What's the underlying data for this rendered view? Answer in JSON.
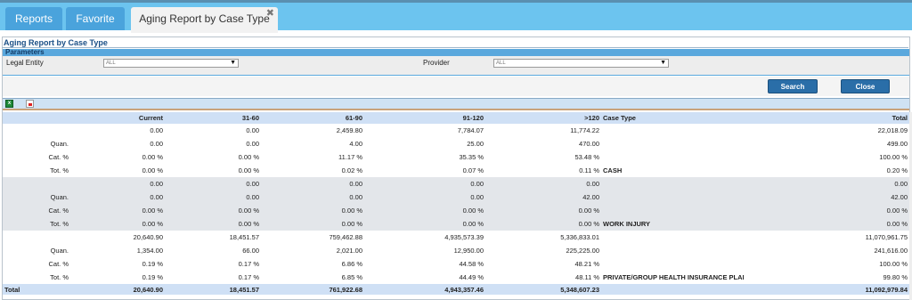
{
  "tabs": [
    {
      "label": "Reports"
    },
    {
      "label": "Favorite"
    },
    {
      "label": "Aging Report by Case Type",
      "active": true,
      "close": "✖"
    }
  ],
  "report": {
    "title": "Aging Report by Case Type",
    "parameters_label": "Parameters",
    "legal_entity": {
      "label": "Legal Entity",
      "value": "ALL"
    },
    "provider": {
      "label": "Provider",
      "value": "ALL"
    },
    "search_label": "Search",
    "close_label": "Close"
  },
  "table": {
    "headers": [
      "",
      "Current",
      "31-60",
      "61-90",
      "91-120",
      ">120",
      "Case Type",
      "Total"
    ],
    "groups": [
      {
        "case_type": "CASH",
        "rows": [
          {
            "label": "",
            "values": [
              "0.00",
              "0.00",
              "2,459.80",
              "7,784.07",
              "11,774.22"
            ],
            "total": "22,018.09"
          },
          {
            "label": "Quan.",
            "values": [
              "0.00",
              "0.00",
              "4.00",
              "25.00",
              "470.00"
            ],
            "total": "499.00"
          },
          {
            "label": "Cat. %",
            "values": [
              "0.00 %",
              "0.00 %",
              "11.17 %",
              "35.35 %",
              "53.48 %"
            ],
            "total": "100.00 %"
          },
          {
            "label": "Tot. %",
            "values": [
              "0.00 %",
              "0.00 %",
              "0.02 %",
              "0.07 %",
              "0.11 %"
            ],
            "total": "0.20 %"
          }
        ]
      },
      {
        "case_type": "WORK INJURY",
        "rows": [
          {
            "label": "",
            "values": [
              "0.00",
              "0.00",
              "0.00",
              "0.00",
              "0.00"
            ],
            "total": "0.00"
          },
          {
            "label": "Quan.",
            "values": [
              "0.00",
              "0.00",
              "0.00",
              "0.00",
              "42.00"
            ],
            "total": "42.00"
          },
          {
            "label": "Cat. %",
            "values": [
              "0.00 %",
              "0.00 %",
              "0.00 %",
              "0.00 %",
              "0.00 %"
            ],
            "total": "0.00 %"
          },
          {
            "label": "Tot. %",
            "values": [
              "0.00 %",
              "0.00 %",
              "0.00 %",
              "0.00 %",
              "0.00 %"
            ],
            "total": "0.00 %"
          }
        ]
      },
      {
        "case_type": "PRIVATE/GROUP HEALTH INSURANCE PLAN",
        "rows": [
          {
            "label": "",
            "values": [
              "20,640.90",
              "18,451.57",
              "759,462.88",
              "4,935,573.39",
              "5,336,833.01"
            ],
            "total": "11,070,961.75"
          },
          {
            "label": "Quan.",
            "values": [
              "1,354.00",
              "66.00",
              "2,021.00",
              "12,950.00",
              "225,225.00"
            ],
            "total": "241,616.00"
          },
          {
            "label": "Cat. %",
            "values": [
              "0.19 %",
              "0.17 %",
              "6.86 %",
              "44.58 %",
              "48.21 %"
            ],
            "total": "100.00 %"
          },
          {
            "label": "Tot. %",
            "values": [
              "0.19 %",
              "0.17 %",
              "6.85 %",
              "44.49 %",
              "48.11 %"
            ],
            "total": "99.80 %"
          }
        ]
      }
    ],
    "total_row": {
      "label": "Total",
      "values": [
        "20,640.90",
        "18,451.57",
        "761,922.68",
        "4,943,357.46",
        "5,348,607.23"
      ],
      "total": "11,092,979.84"
    }
  }
}
